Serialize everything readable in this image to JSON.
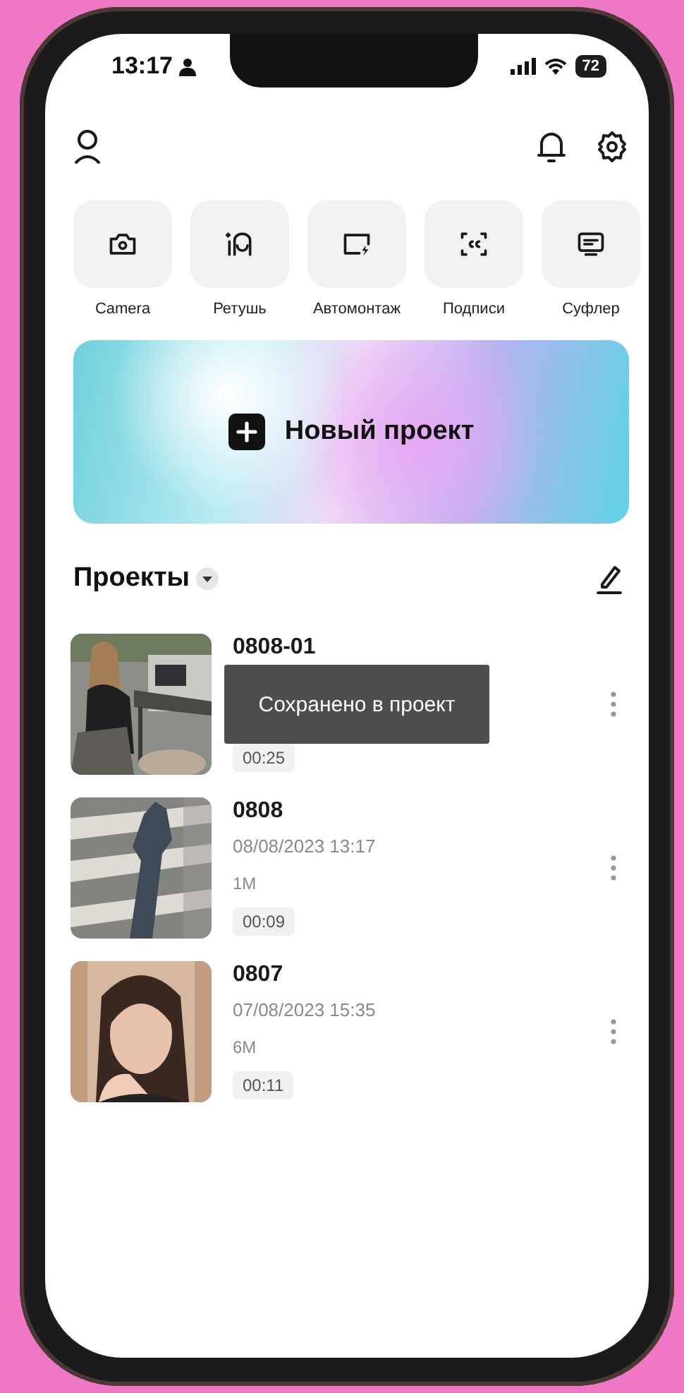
{
  "status_bar": {
    "time": "13:17",
    "battery": "72"
  },
  "tools": [
    {
      "label": "Camera"
    },
    {
      "label": "Ретушь"
    },
    {
      "label": "Автомонтаж"
    },
    {
      "label": "Подписи"
    },
    {
      "label": "Суфлер"
    }
  ],
  "banner": {
    "label": "Новый проект"
  },
  "projects_header": {
    "title": "Проекты"
  },
  "projects": [
    {
      "name": "0808-01",
      "duration": "00:25"
    },
    {
      "name": "0808",
      "date": "08/08/2023 13:17",
      "size": "1M",
      "duration": "00:09"
    },
    {
      "name": "0807",
      "date": "07/08/2023 15:35",
      "size": "6M",
      "duration": "00:11"
    }
  ],
  "toast": {
    "text": "Сохранено в проект"
  }
}
